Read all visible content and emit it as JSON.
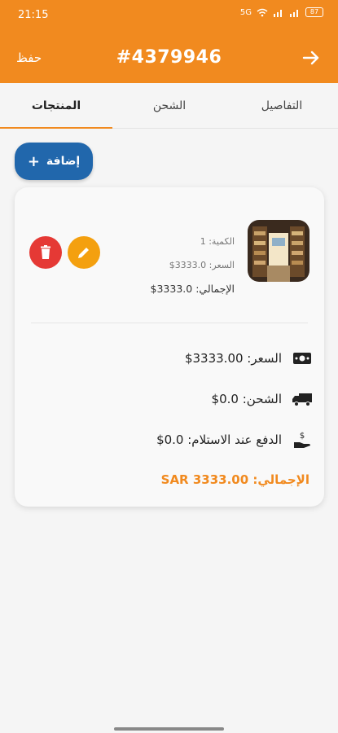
{
  "status_bar": {
    "time": "21:15",
    "signal_text": "5G",
    "battery": "87"
  },
  "header": {
    "save_label": "حفظ",
    "order_number": "#4379946"
  },
  "tabs": [
    {
      "label": "التفاصيل"
    },
    {
      "label": "الشحن"
    },
    {
      "label": "المنتجات"
    }
  ],
  "add_button": {
    "label": "إضافة",
    "icon": "+"
  },
  "product": {
    "quantity": "الكمية: 1",
    "price": "السعر: 3333.0$",
    "total": "الإجمالي: 3333.0$"
  },
  "summary": {
    "price": "السعر: 3333.00$",
    "shipping": "الشحن: 0.0$",
    "cod": "الدفع عند الاستلام: 0.0$",
    "grand_total": "الإجمالي: SAR 3333.00"
  },
  "colors": {
    "accent": "#f18a1f",
    "primary": "#2167ac",
    "danger": "#e53935",
    "warning": "#f4a00f"
  }
}
